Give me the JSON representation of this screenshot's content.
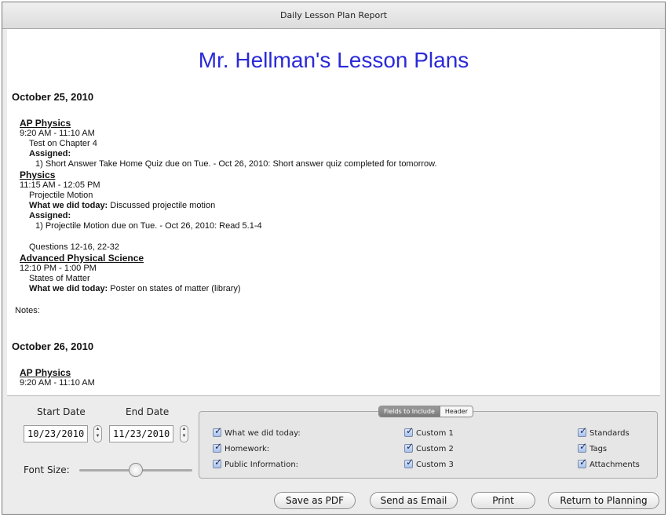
{
  "window": {
    "title": "Daily Lesson Plan Report"
  },
  "report": {
    "title": "Mr. Hellman's Lesson Plans",
    "days": [
      {
        "date": "October 25, 2010",
        "entries": [
          {
            "course": "AP Physics",
            "time": "9:20 AM - 11:10 AM",
            "topic": "Test on Chapter 4",
            "assigned_label": "Assigned:",
            "assigned_item": "1) Short Answer Take Home Quiz due on Tue. - Oct 26, 2010: Short answer quiz completed for tomorrow."
          },
          {
            "course": "Physics",
            "time": "11:15 AM - 12:05 PM",
            "topic": "Projectile Motion",
            "wwdt_label": "What we did today:",
            "wwdt_value": "Discussed projectile motion",
            "assigned_label": "Assigned:",
            "assigned_item": "1) Projectile Motion due on Tue. - Oct 26, 2010: Read 5.1-4",
            "extra": "Questions 12-16, 22-32"
          },
          {
            "course": "Advanced Physical Science",
            "time": "12:10 PM - 1:00 PM",
            "topic": "States of Matter",
            "wwdt_label": "What we did today:",
            "wwdt_value": "Poster on states of matter (library)"
          }
        ],
        "notes_label": "Notes:"
      },
      {
        "date": "October 26, 2010",
        "entries": [
          {
            "course": "AP Physics",
            "time": "9:20 AM - 11:10 AM"
          }
        ]
      }
    ]
  },
  "controls": {
    "start_date_label": "Start Date",
    "start_date": "10/23/2010",
    "end_date_label": "End Date",
    "end_date": "11/23/2010",
    "font_size_label": "Font Size:",
    "font_size_level": 0.5,
    "tabs": [
      "Fields to Include",
      "Header"
    ],
    "selected_tab": "Fields to Include",
    "checkboxes": [
      {
        "label": "What we did today:",
        "checked": true
      },
      {
        "label": "Homework:",
        "checked": true
      },
      {
        "label": "Public Information:",
        "checked": true
      },
      {
        "label": "Custom 1",
        "checked": true
      },
      {
        "label": "Custom 2",
        "checked": true
      },
      {
        "label": "Custom 3",
        "checked": true
      },
      {
        "label": "Standards",
        "checked": true
      },
      {
        "label": "Tags",
        "checked": true
      },
      {
        "label": "Attachments",
        "checked": true
      }
    ],
    "buttons": {
      "save_pdf": "Save as PDF",
      "send_email": "Send as Email",
      "print": "Print",
      "return": "Return to Planning"
    }
  }
}
